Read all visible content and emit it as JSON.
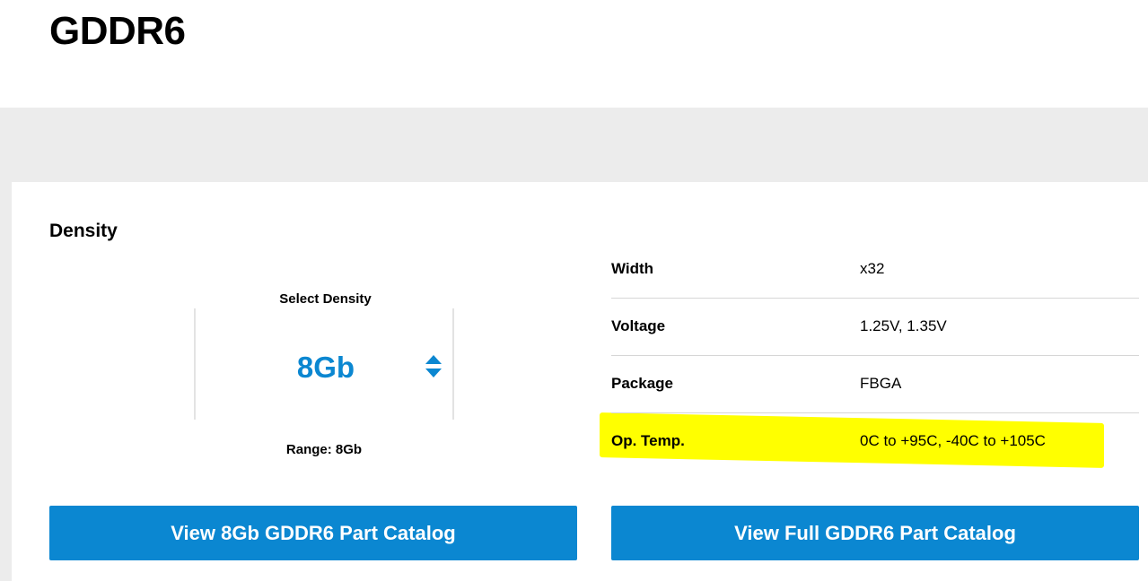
{
  "page": {
    "title": "GDDR6"
  },
  "density": {
    "section_title": "Density",
    "selector_label": "Select Density",
    "selected_value": "8Gb",
    "range_text": "Range: 8Gb",
    "stepper_icon": "up-down-arrows-icon"
  },
  "specs": [
    {
      "label": "Width",
      "value": "x32"
    },
    {
      "label": "Voltage",
      "value": "1.25V, 1.35V"
    },
    {
      "label": "Package",
      "value": "FBGA"
    },
    {
      "label": "Op. Temp.",
      "value": "0C to +95C, -40C to +105C",
      "highlighted": true
    }
  ],
  "buttons": {
    "left_label": "View 8Gb GDDR6 Part Catalog",
    "right_label": "View Full GDDR6 Part Catalog"
  },
  "colors": {
    "accent": "#0b87d1",
    "highlight": "#ffff00",
    "band": "#ececec"
  }
}
